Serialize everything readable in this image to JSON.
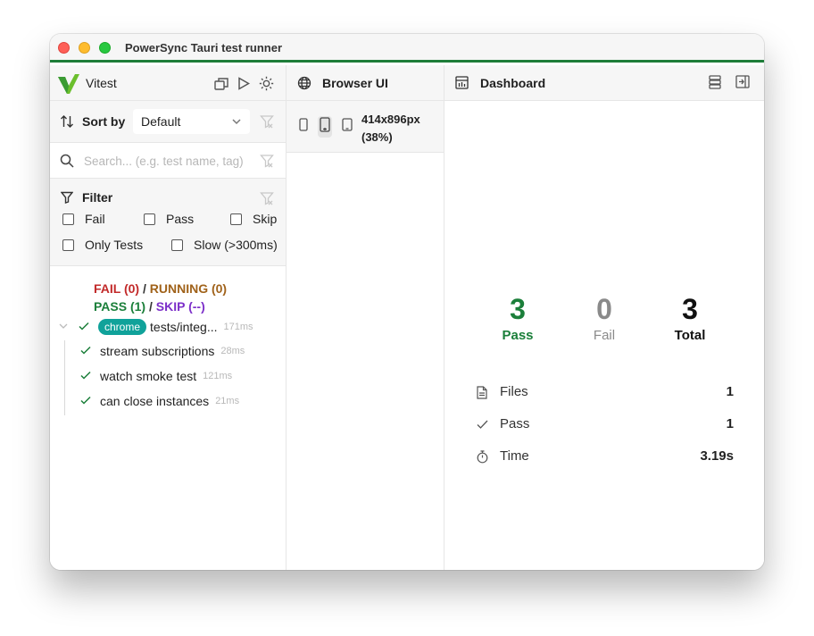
{
  "window": {
    "title": "PowerSync Tauri test runner"
  },
  "sidebar": {
    "app_name": "Vitest",
    "sort": {
      "label": "Sort by",
      "value": "Default"
    },
    "search": {
      "placeholder": "Search... (e.g. test name, tag)"
    },
    "filter": {
      "label": "Filter",
      "options": {
        "fail": "Fail",
        "pass": "Pass",
        "skip": "Skip",
        "only_tests": "Only Tests",
        "slow": "Slow (>300ms)"
      }
    },
    "summary": {
      "fail": "FAIL (0)",
      "running": "RUNNING (0)",
      "pass": "PASS (1)",
      "skip": "SKIP (--)",
      "separator": "/"
    },
    "tree": {
      "file": {
        "badge": "chrome",
        "name": "tests/integ...",
        "duration": "171ms"
      },
      "tests": [
        {
          "name": "stream subscriptions",
          "duration": "28ms"
        },
        {
          "name": "watch smoke test",
          "duration": "121ms"
        },
        {
          "name": "can close instances",
          "duration": "21ms"
        }
      ]
    }
  },
  "browser": {
    "title": "Browser UI",
    "viewport_line1": "414x896px",
    "viewport_line2": "(38%)"
  },
  "dashboard": {
    "title": "Dashboard",
    "stats": {
      "pass": {
        "value": "3",
        "label": "Pass"
      },
      "fail": {
        "value": "0",
        "label": "Fail"
      },
      "total": {
        "value": "3",
        "label": "Total"
      }
    },
    "details": {
      "files": {
        "label": "Files",
        "value": "1"
      },
      "pass": {
        "label": "Pass",
        "value": "1"
      },
      "time": {
        "label": "Time",
        "value": "3.19s"
      }
    }
  },
  "colors": {
    "accent_green": "#1e7d39",
    "pass": "#1b7f3a",
    "fail": "#c22a2a",
    "running": "#a0621a",
    "skip": "#7c2fc9",
    "badge": "#10a29a"
  }
}
